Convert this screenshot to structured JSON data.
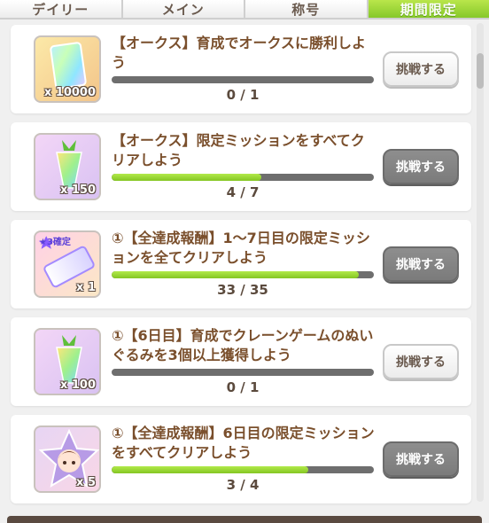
{
  "tabs": [
    {
      "label": "デイリー",
      "active": false
    },
    {
      "label": "メイン",
      "active": false
    },
    {
      "label": "称号",
      "active": false
    },
    {
      "label": "期間限定",
      "active": true
    }
  ],
  "missions": [
    {
      "title": "【オークス】育成でオークスに勝利しよう",
      "reward_qty": "x 10000",
      "reward_icon": "rainbow-card-icon",
      "progress_text": "0 / 1",
      "progress_fraction": 0.0,
      "button_label": "挑戦する",
      "button_disabled": false
    },
    {
      "title": "【オークス】限定ミッションをすべてクリアしよう",
      "reward_qty": "x 150",
      "reward_icon": "carrot-jewel-icon",
      "progress_text": "4 / 7",
      "progress_fraction": 0.571,
      "button_label": "挑戦する",
      "button_disabled": true
    },
    {
      "title": "①【全達成報酬】1～7日目の限定ミッションを全てクリアしよう",
      "reward_qty": "x 1",
      "reward_icon": "star3-ticket-icon",
      "badge": "★3確定",
      "progress_text": "33 / 35",
      "progress_fraction": 0.943,
      "button_label": "挑戦する",
      "button_disabled": true
    },
    {
      "title": "①【6日目】育成でクレーンゲームのぬいぐるみを3個以上獲得しよう",
      "reward_qty": "x 100",
      "reward_icon": "carrot-jewel-icon",
      "progress_text": "0 / 1",
      "progress_fraction": 0.0,
      "button_label": "挑戦する",
      "button_disabled": false
    },
    {
      "title": "①【全達成報酬】6日目の限定ミッションをすべてクリアしよう",
      "reward_qty": "x 5",
      "reward_icon": "character-portrait-icon",
      "progress_text": "3 / 4",
      "progress_fraction": 0.75,
      "button_label": "挑戦する",
      "button_disabled": true
    }
  ]
}
